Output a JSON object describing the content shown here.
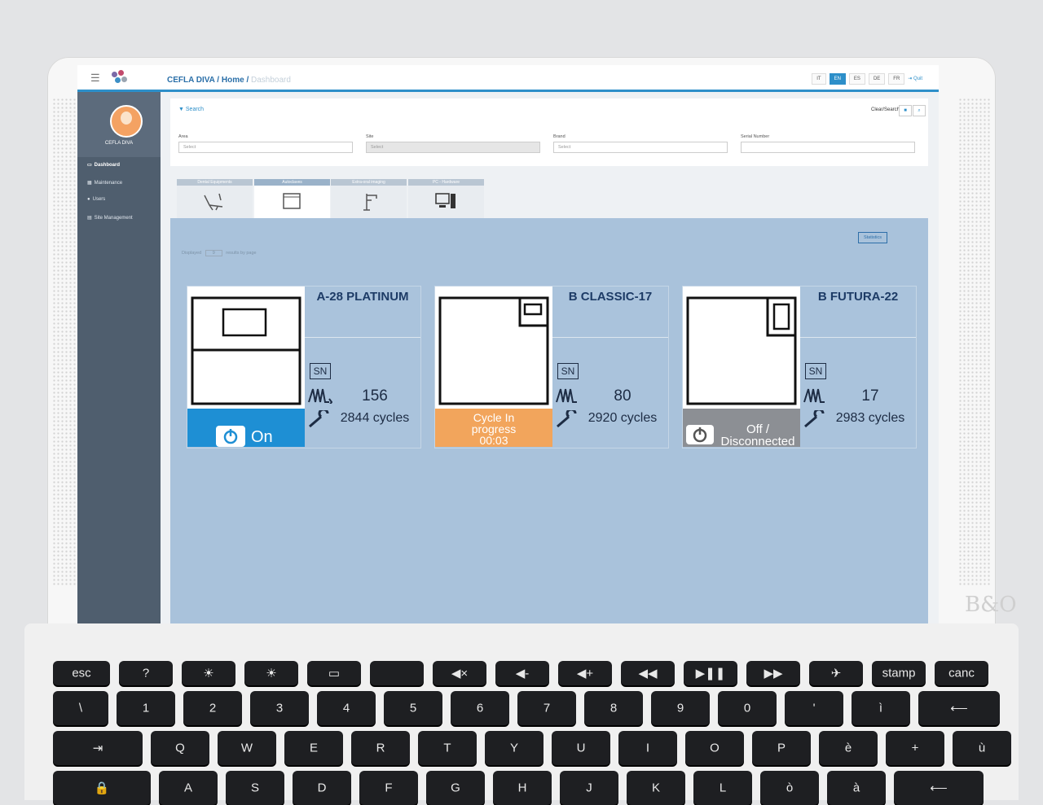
{
  "app": {
    "breadcrumb": {
      "root": "CEFLA DIVA",
      "sep1": "/",
      "home": "Home",
      "sep2": "/",
      "current": "Dashboard"
    },
    "languages": [
      "IT",
      "EN",
      "ES",
      "DE",
      "FR"
    ],
    "active_language": "EN",
    "quit_label": "Quit"
  },
  "sidebar": {
    "user_name": "CEFLA DIVA",
    "items": [
      {
        "label": "Dashboard",
        "icon": "monitor-icon",
        "active": true
      },
      {
        "label": "Maintenance",
        "icon": "calendar-icon",
        "active": false
      },
      {
        "label": "Users",
        "icon": "users-icon",
        "active": false
      },
      {
        "label": "Site Management",
        "icon": "building-icon",
        "active": false
      }
    ]
  },
  "search": {
    "title": "Search",
    "clear_label": "Clear/Search",
    "fields": [
      {
        "label": "Area",
        "placeholder": "Select",
        "disabled": false
      },
      {
        "label": "Site",
        "placeholder": "Select",
        "disabled": true
      },
      {
        "label": "Brand",
        "placeholder": "Select",
        "disabled": false
      },
      {
        "label": "Serial Number",
        "placeholder": "",
        "disabled": false
      }
    ]
  },
  "tabs": [
    {
      "label": "Dental Equipments",
      "icon": "dental-chair-icon"
    },
    {
      "label": "Autoclaves",
      "icon": "autoclave-icon",
      "active": true
    },
    {
      "label": "Extra-oral imaging",
      "icon": "xray-icon"
    },
    {
      "label": "PC - Hardware",
      "icon": "computer-icon"
    }
  ],
  "panel": {
    "statistics_label": "Statistics",
    "displayed_label": "Displayed",
    "page_size": "9",
    "results_label": "results by page"
  },
  "devices": [
    {
      "name": "A-28 PLATINUM",
      "sn_label": "SN",
      "count": "156",
      "cycles": "2844 cycles",
      "status_line1": "On",
      "status_line2": "",
      "status_line3": "",
      "status_color": "#1e8fd4",
      "status_icon": "power-icon"
    },
    {
      "name": "B CLASSIC-17",
      "sn_label": "SN",
      "count": "80",
      "cycles": "2920 cycles",
      "status_line1": "Cycle In",
      "status_line2": "progress",
      "status_line3": "00:03",
      "status_color": "#f2a55c",
      "status_icon": ""
    },
    {
      "name": "B FUTURA-22",
      "sn_label": "SN",
      "count": "17",
      "cycles": "2983 cycles",
      "status_line1": "Off /",
      "status_line2": "Disconnected",
      "status_line3": "",
      "status_color": "#8c8f94",
      "status_icon": "power-icon"
    }
  ],
  "keyboard": {
    "row1": [
      "esc",
      "?",
      "☀",
      "☀",
      "▭",
      "",
      "◀×",
      "◀-",
      "◀+",
      "◀◀",
      "▶❚❚",
      "▶▶",
      "✈",
      "stamp",
      "canc"
    ],
    "row2": [
      "\\",
      "1",
      "2",
      "3",
      "4",
      "5",
      "6",
      "7",
      "8",
      "9",
      "0",
      "'",
      "ì",
      "⟵"
    ],
    "row3": [
      "⇥",
      "Q",
      "W",
      "E",
      "R",
      "T",
      "Y",
      "U",
      "I",
      "O",
      "P",
      "è",
      "+",
      "ù"
    ],
    "row4": [
      "🔒",
      "A",
      "S",
      "D",
      "F",
      "G",
      "H",
      "J",
      "K",
      "L",
      "ò",
      "à",
      "⟵"
    ],
    "brand_mark": "B&O"
  }
}
